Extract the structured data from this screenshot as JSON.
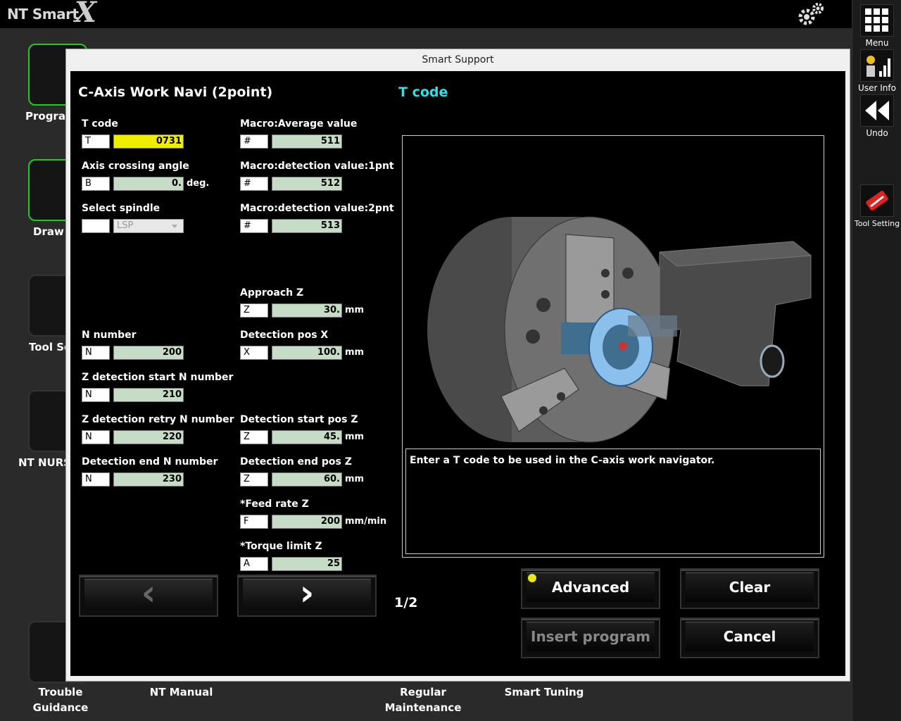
{
  "app": {
    "logo_text": "NT Smart",
    "logo_x": "X"
  },
  "right_bar": {
    "menu": "Menu",
    "user_info": "User Info",
    "undo": "Undo",
    "tool_setting": "Tool Setting"
  },
  "desktop": {
    "program": "Program",
    "draw": "Draw",
    "tool_setup": "Tool Se",
    "nt_nurse": "NT NURS",
    "trouble_guidance": "Trouble\nGuidance",
    "nt_manual": "NT Manual",
    "regular_maintenance": "Regular\nMaintenance",
    "smart_tuning": "Smart Tuning"
  },
  "dialog": {
    "title": "Smart Support",
    "heading": "C-Axis Work Navi (2point)",
    "image_heading": "T code",
    "message": "Enter a T code to be used in the C-axis work navigator.",
    "page": "1/2"
  },
  "fields": {
    "t_code": {
      "label": "T code",
      "prefix": "T",
      "value": "0731"
    },
    "axis_angle": {
      "label": "Axis crossing angle",
      "prefix": "B",
      "value": "0.",
      "unit": "deg."
    },
    "spindle": {
      "label": "Select spindle",
      "value": "LSP"
    },
    "macro_avg": {
      "label": "Macro:Average value",
      "prefix": "#",
      "value": "511"
    },
    "macro_1pnt": {
      "label": "Macro:detection value:1pnt",
      "prefix": "#",
      "value": "512"
    },
    "macro_2pnt": {
      "label": "Macro:detection value:2pnt",
      "prefix": "#",
      "value": "513"
    },
    "approach_z": {
      "label": "Approach Z",
      "prefix": "Z",
      "value": "30.",
      "unit": "mm"
    },
    "n_number": {
      "label": "N number",
      "prefix": "N",
      "value": "200"
    },
    "det_pos_x": {
      "label": "Detection pos X",
      "prefix": "X",
      "value": "100.",
      "unit": "mm"
    },
    "z_start_n": {
      "label": "Z detection start N number",
      "prefix": "N",
      "value": "210"
    },
    "z_retry_n": {
      "label": "Z detection retry N number",
      "prefix": "N",
      "value": "220"
    },
    "det_start_z": {
      "label": "Detection start pos Z",
      "prefix": "Z",
      "value": "45.",
      "unit": "mm"
    },
    "det_end_n": {
      "label": "Detection end N number",
      "prefix": "N",
      "value": "230"
    },
    "det_end_z": {
      "label": "Detection end pos Z",
      "prefix": "Z",
      "value": "60.",
      "unit": "mm"
    },
    "feed_rate": {
      "label": "*Feed rate Z",
      "prefix": "F",
      "value": "200",
      "unit": "mm/min"
    },
    "torque": {
      "label": "*Torque limit Z",
      "prefix": "A",
      "value": "25"
    }
  },
  "buttons": {
    "advanced": "Advanced",
    "clear": "Clear",
    "insert": "Insert program",
    "cancel": "Cancel",
    "prev": "‹",
    "next": "›"
  }
}
